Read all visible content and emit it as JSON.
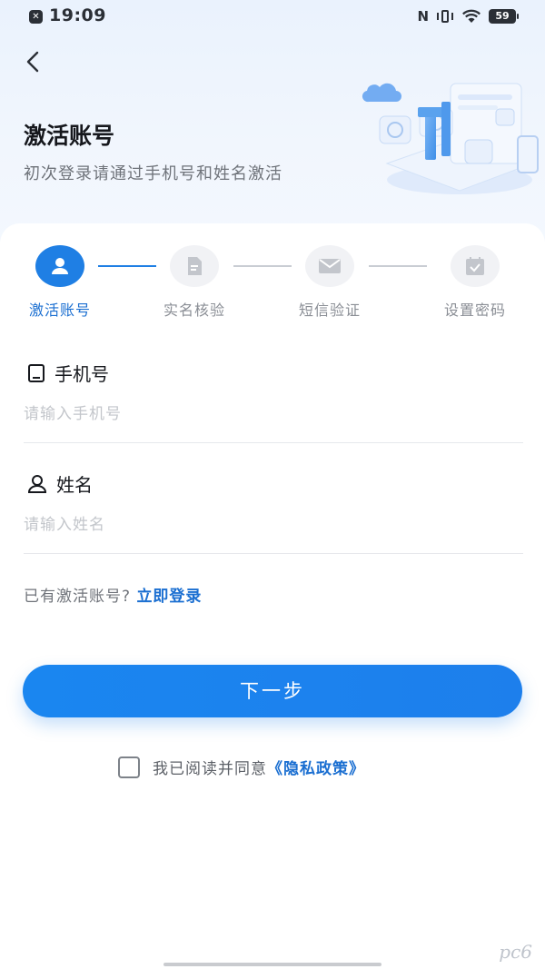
{
  "status_bar": {
    "time": "19:09",
    "app_icon": "x-app-icon",
    "nfc": "N",
    "battery": "59"
  },
  "header": {
    "title": "激活账号",
    "subtitle": "初次登录请通过手机号和姓名激活"
  },
  "steps": [
    {
      "label": "激活账号",
      "icon": "user-icon",
      "active": true
    },
    {
      "label": "实名核验",
      "icon": "document-icon",
      "active": false
    },
    {
      "label": "短信验证",
      "icon": "envelope-icon",
      "active": false
    },
    {
      "label": "设置密码",
      "icon": "checkmark-icon",
      "active": false
    }
  ],
  "form": {
    "phone": {
      "label": "手机号",
      "placeholder": "请输入手机号",
      "value": ""
    },
    "name": {
      "label": "姓名",
      "placeholder": "请输入姓名",
      "value": ""
    }
  },
  "login_prompt": {
    "text": "已有激活账号?",
    "link": "立即登录"
  },
  "next_button": "下一步",
  "agreement": {
    "text": "我已阅读并同意",
    "link": "《隐私政策》",
    "checked": false
  },
  "watermark": "pc6",
  "colors": {
    "accent": "#1f7fe4",
    "link": "#1b6fd1",
    "hero_bg": "#eaf2fd"
  }
}
